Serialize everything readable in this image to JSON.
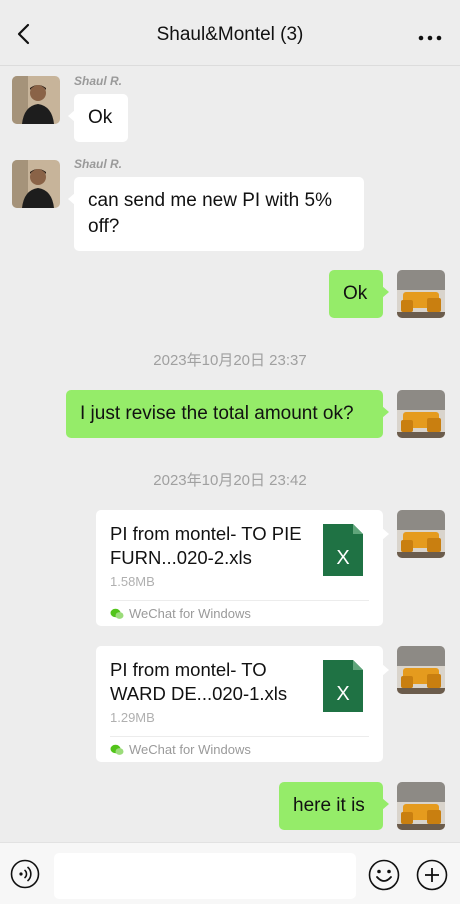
{
  "header": {
    "title": "Shaul&Montel (3)",
    "back_icon": "chevron-left-icon",
    "more_icon": "more-dots-icon"
  },
  "messages": [
    {
      "sender": "Shaul R.",
      "text": "Ok",
      "direction": "incoming"
    },
    {
      "sender": "Shaul R.",
      "text": "can send me new PI with 5% off?",
      "direction": "incoming"
    },
    {
      "text": "Ok",
      "direction": "outgoing"
    },
    {
      "timestamp": "2023年10月20日 23:37"
    },
    {
      "text": "I just revise the total amount ok?",
      "direction": "outgoing"
    },
    {
      "timestamp": "2023年10月20日 23:42"
    }
  ],
  "files": [
    {
      "name": "PI from montel- TO PIE FURN...020-2.xls",
      "size": "1.58MB",
      "source": "WeChat for Windows"
    },
    {
      "name": "PI from montel- TO WARD DE...020-1.xls",
      "size": "1.29MB",
      "source": "WeChat for Windows"
    }
  ],
  "last_message": {
    "text": "here it is",
    "direction": "outgoing"
  },
  "footer": {
    "input_value": "",
    "voice_icon": "voice-icon",
    "emoji_icon": "emoji-icon",
    "plus_icon": "plus-icon"
  },
  "colors": {
    "outgoing_bubble": "#95ec69",
    "incoming_bubble": "#ffffff",
    "background": "#ededed",
    "excel_green": "#1f7244"
  }
}
